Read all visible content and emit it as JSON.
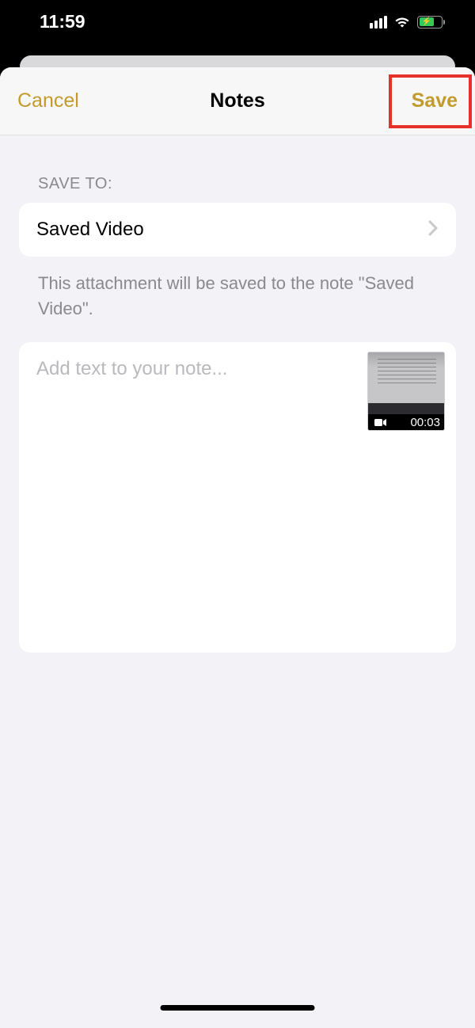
{
  "status": {
    "time": "11:59"
  },
  "nav": {
    "cancel": "Cancel",
    "title": "Notes",
    "save": "Save"
  },
  "section": {
    "label": "SAVE TO:",
    "destination": "Saved Video",
    "explain": "This attachment will be saved to the note \"Saved Video\"."
  },
  "note": {
    "placeholder": "Add text to your note..."
  },
  "attachment": {
    "duration": "00:03"
  }
}
